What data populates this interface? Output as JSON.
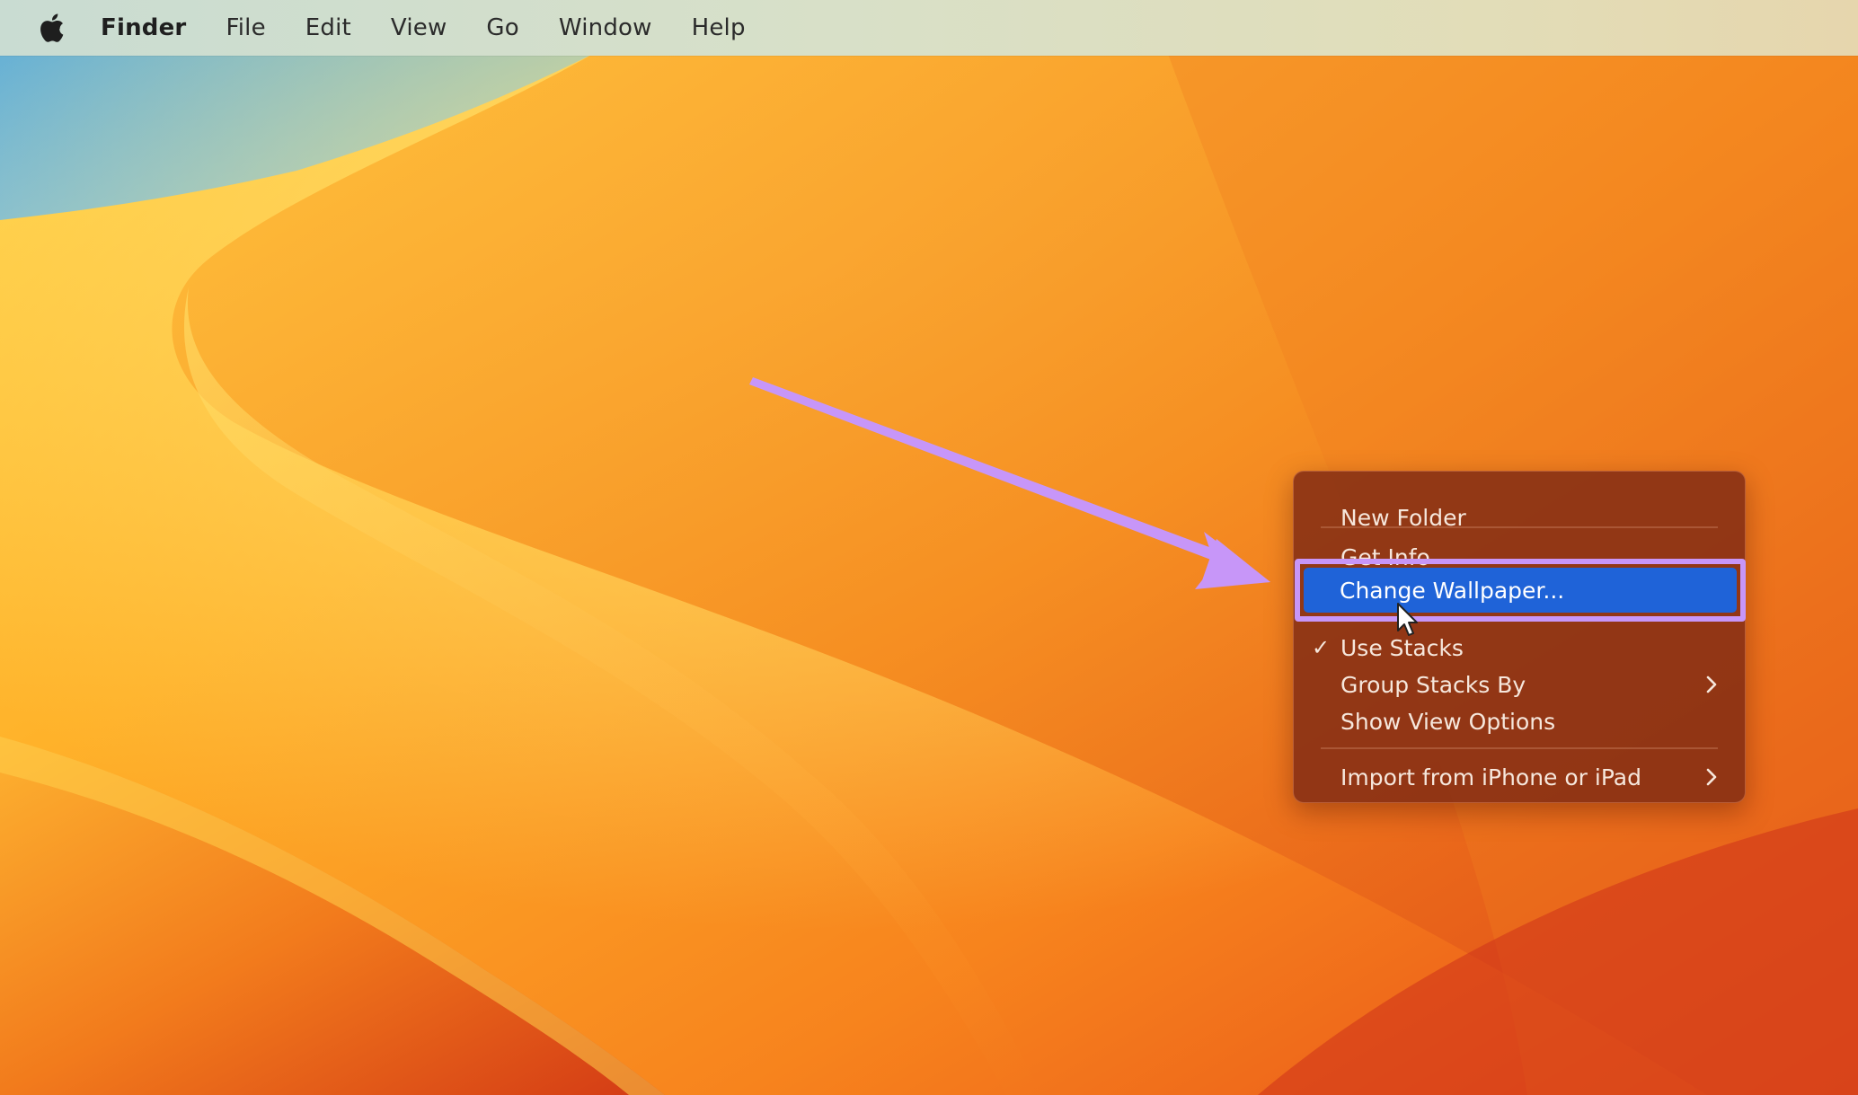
{
  "menubar": {
    "apple_icon": "apple-logo-icon",
    "app_name": "Finder",
    "items": [
      "File",
      "Edit",
      "View",
      "Go",
      "Window",
      "Help"
    ]
  },
  "context_menu": {
    "new_folder": "New Folder",
    "get_info": "Get Info",
    "change_wallpaper": "Change Wallpaper...",
    "use_stacks": "Use Stacks",
    "use_stacks_checked": true,
    "group_stacks_by": "Group Stacks By",
    "show_view_options": "Show View Options",
    "import_from_device": "Import from iPhone or iPad",
    "highlighted_item": "Change Wallpaper..."
  },
  "annotation": {
    "arrow_color": "#c796f8",
    "highlight_color": "#c796f8",
    "selection_color": "#1f63d8"
  },
  "icons": {
    "check": "checkmark-icon",
    "submenu": "chevron-right-icon",
    "pointer": "mouse-pointer-icon"
  }
}
